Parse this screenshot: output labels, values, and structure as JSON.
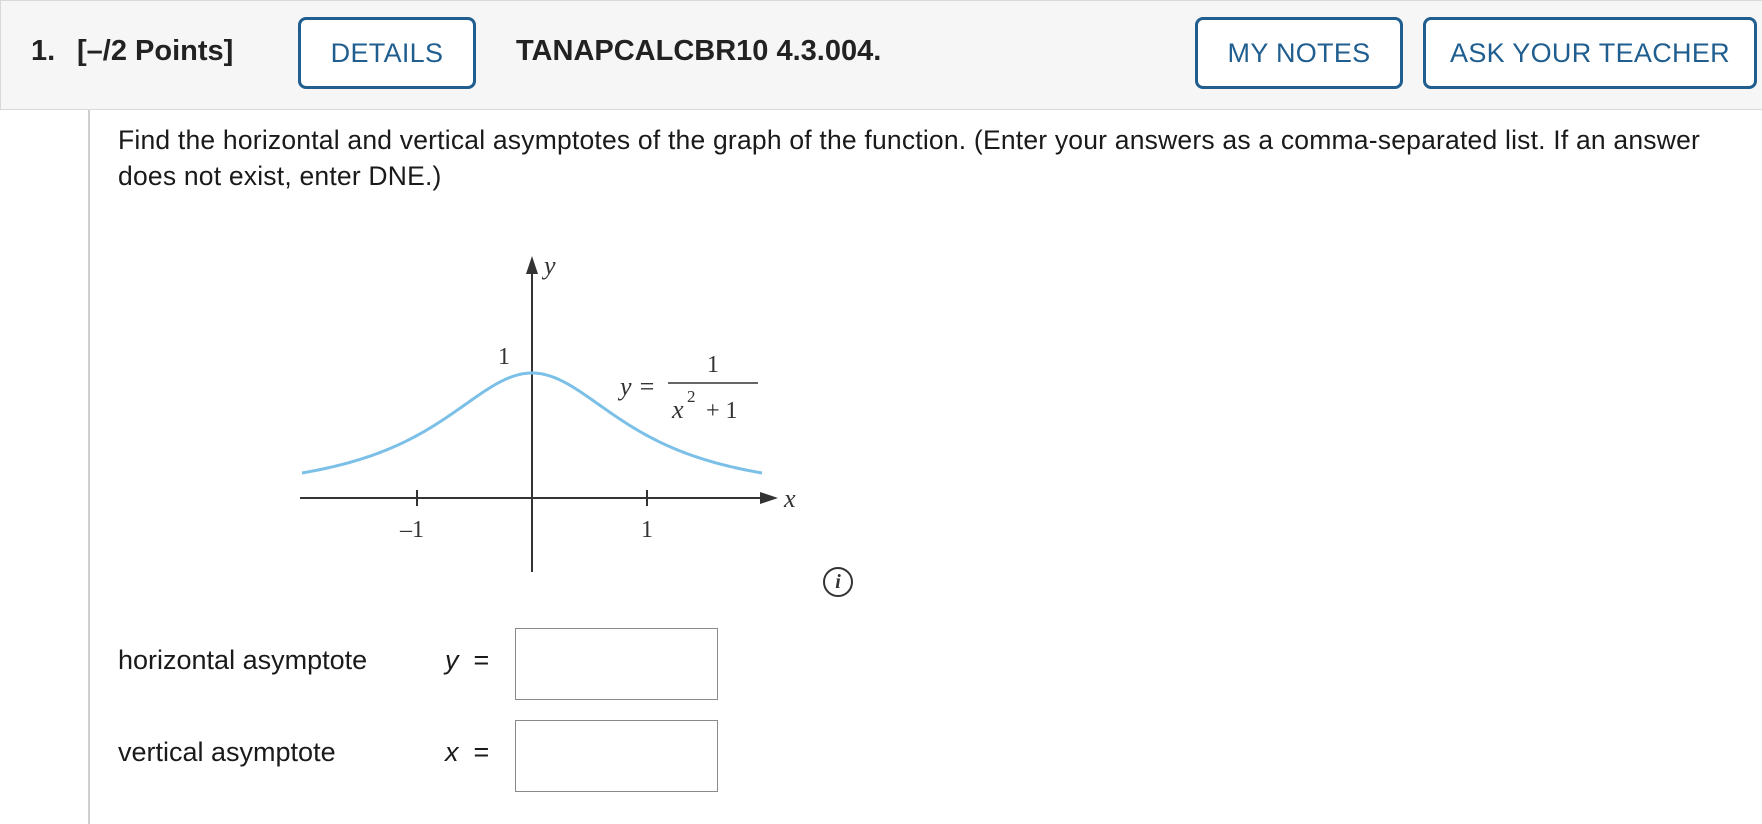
{
  "header": {
    "question_number": "1.",
    "points": "[–/2 Points]",
    "details_label": "DETAILS",
    "question_code": "TANAPCALCBR10 4.3.004.",
    "my_notes_label": "MY NOTES",
    "ask_teacher_label": "ASK YOUR TEACHER"
  },
  "question": {
    "prompt": "Find the horizontal and vertical asymptotes of the graph of the function. (Enter your answers as a comma-separated list. If an answer does not exist, enter DNE.)"
  },
  "graph": {
    "y_axis_label": "y",
    "x_axis_label": "x",
    "y_tick_label": "1",
    "x_tick_neg_label": "–1",
    "x_tick_pos_label": "1",
    "equation_lhs": "y =",
    "equation_numerator": "1",
    "equation_denominator_base": "x",
    "equation_denominator_exp": "2",
    "equation_denominator_rest": " + 1",
    "curve_color": "#7cc0e8",
    "info_icon": "info-icon"
  },
  "answers": {
    "horizontal_label": "horizontal asymptote",
    "horizontal_var": "y",
    "horizontal_eq": "=",
    "horizontal_value": "",
    "vertical_label": "vertical asymptote",
    "vertical_var": "x",
    "vertical_eq": "=",
    "vertical_value": ""
  },
  "colors": {
    "accent": "#1f5e8f",
    "header_bg": "#f6f6f6"
  }
}
